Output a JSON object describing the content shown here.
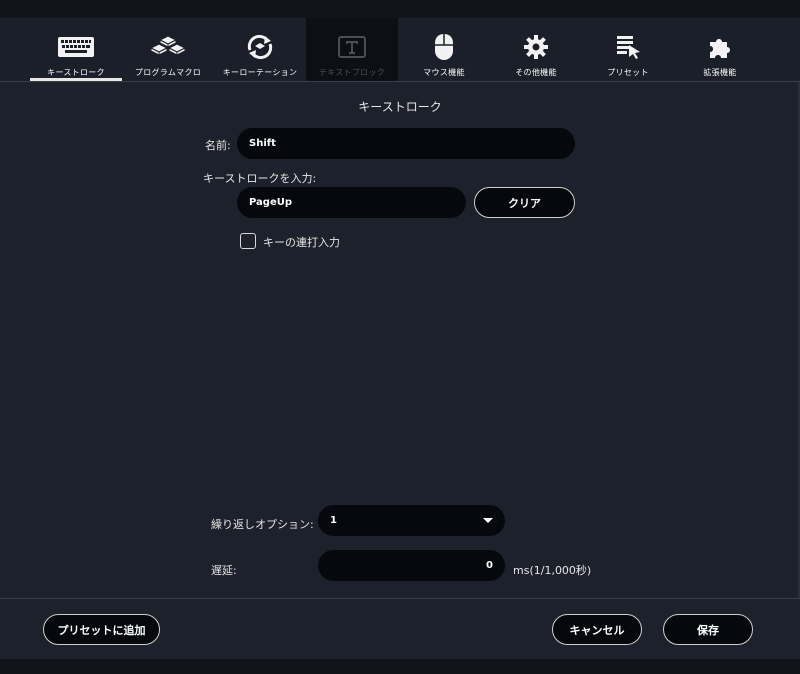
{
  "tabs": [
    {
      "label": "キーストローク",
      "icon": "keyboard-icon",
      "active": true,
      "disabled": false
    },
    {
      "label": "プログラムマクロ",
      "icon": "macro-keys-icon",
      "active": false,
      "disabled": false
    },
    {
      "label": "キーローテーション",
      "icon": "rotation-icon",
      "active": false,
      "disabled": false
    },
    {
      "label": "テキストブロック",
      "icon": "text-block-icon",
      "active": false,
      "disabled": true
    },
    {
      "label": "マウス機能",
      "icon": "mouse-icon",
      "active": false,
      "disabled": false
    },
    {
      "label": "その他機能",
      "icon": "gear-icon",
      "active": false,
      "disabled": false
    },
    {
      "label": "プリセット",
      "icon": "preset-list-icon",
      "active": false,
      "disabled": false
    },
    {
      "label": "拡張機能",
      "icon": "puzzle-icon",
      "active": false,
      "disabled": false
    }
  ],
  "page_title": "キーストローク",
  "form": {
    "name_label": "名前:",
    "name_value": "Shift",
    "keystroke_label": "キーストロークを入力:",
    "keystroke_value": "PageUp",
    "clear_label": "クリア",
    "repeat_checkbox_label": "キーの連打入力",
    "repeat_checked": false,
    "repeat_option_label": "繰り返しオプション:",
    "repeat_option_value": "1",
    "delay_label": "遅延:",
    "delay_value": "0",
    "delay_unit": "ms(1/1,000秒)"
  },
  "footer": {
    "add_preset_label": "プリセットに追加",
    "cancel_label": "キャンセル",
    "save_label": "保存"
  },
  "colors": {
    "background": "#1d212b",
    "input_bg": "#05080d",
    "tab_bar": "#1b1f29",
    "disabled_tab": "#0c0f14"
  }
}
